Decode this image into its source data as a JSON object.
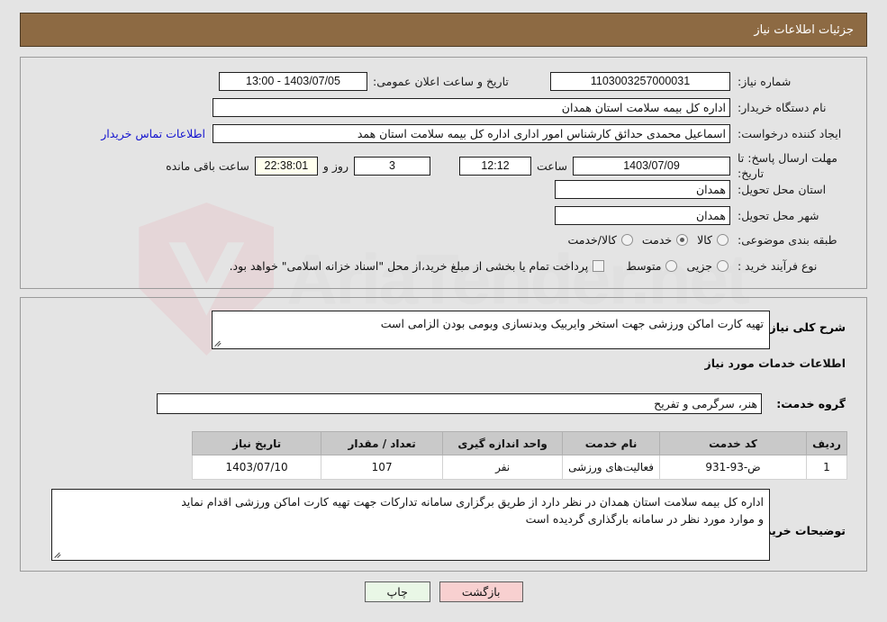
{
  "window": {
    "title": "جزئیات اطلاعات نیاز"
  },
  "colors": {
    "title_bar": "#8d6a43",
    "page_bg": "#e4e4e4",
    "link": "#1414cf",
    "timer_bg": "#ffffee",
    "back_button": "#f8d0d0",
    "print_button": "#e9f7e6",
    "table_header": "#c9c9c9"
  },
  "watermark": {
    "text": "AriaTender.net"
  },
  "info": {
    "need_number_label": "شماره نیاز:",
    "need_number_value": "1103003257000031",
    "public_announce_label": "تاریخ و ساعت اعلان عمومی:",
    "public_announce_value": "13:00 - 1403/07/05",
    "buyer_org_label": "نام دستگاه خریدار:",
    "buyer_org_value": "اداره کل بیمه سلامت استان همدان",
    "creator_label": "ایجاد کننده درخواست:",
    "creator_value": "اسماعیل محمدی حدائق کارشناس امور اداری اداره کل بیمه سلامت استان همد",
    "contact_link": "اطلاعات تماس خریدار",
    "deadline_label": "مهلت ارسال پاسخ: تا تاریخ:",
    "deadline_date": "1403/07/09",
    "deadline_hour_label": "ساعت",
    "deadline_hour_value": "12:12",
    "remaining_days": "3",
    "remaining_days_label": "روز و",
    "remaining_time": "22:38:01",
    "remaining_suffix": "ساعت باقی مانده",
    "delivery_province_label": "استان محل تحویل:",
    "delivery_province_value": "همدان",
    "delivery_city_label": "شهر محل تحویل:",
    "delivery_city_value": "همدان",
    "category_label": "طبقه بندی موضوعی:",
    "category_options": [
      {
        "label": "کالا",
        "selected": false
      },
      {
        "label": "خدمت",
        "selected": true
      },
      {
        "label": "کالا/خدمت",
        "selected": false
      }
    ],
    "process_label": "نوع فرآیند خرید :",
    "process_options": [
      {
        "label": "جزیی",
        "selected": false
      },
      {
        "label": "متوسط",
        "selected": false
      }
    ],
    "treasury_checkbox_label": "پرداخت تمام یا بخشی از مبلغ خرید،از محل \"اسناد خزانه اسلامی\" خواهد بود.",
    "treasury_checked": false
  },
  "summary": {
    "label": "شرح کلی نیاز:",
    "value": "تهیه کارت اماکن ورزشی جهت استخر وایربیک وبدنسازی وبومی بودن الزامی است"
  },
  "services_section": {
    "heading": "اطلاعات خدمات مورد نیاز",
    "group_label": "گروه خدمت:",
    "group_value": "هنر، سرگرمی و تفریح"
  },
  "table": {
    "headers": [
      "ردیف",
      "کد خدمت",
      "نام خدمت",
      "واحد اندازه گیری",
      "تعداد / مقدار",
      "تاریخ نیاز"
    ],
    "rows": [
      {
        "row_no": "1",
        "service_code": "ض-93-931",
        "service_name": "فعالیت‌های ورزشی",
        "unit": "نفر",
        "quantity": "107",
        "need_date": "1403/07/10"
      }
    ]
  },
  "buyer_notes": {
    "label": "توضیحات خریدار:",
    "line1": "اداره کل بیمه سلامت استان همدان در نظر دارد از طریق برگزاری سامانه تدارکات جهت تهیه کارت اماکن  ورزشی اقدام نماید",
    "line2": "و موارد مورد نظر در سامانه بارگذاری گردیده است"
  },
  "buttons": {
    "back": "بازگشت",
    "print": "چاپ"
  }
}
